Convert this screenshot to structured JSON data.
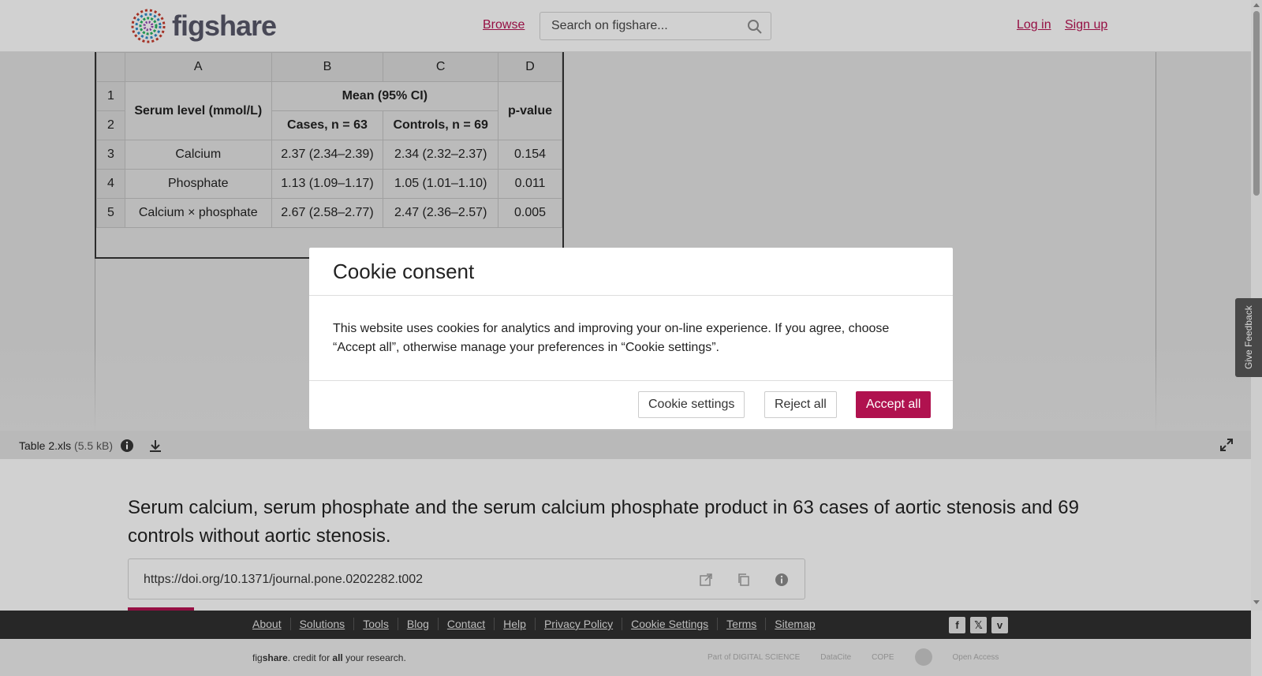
{
  "header": {
    "logo_text": "figshare",
    "browse": "Browse",
    "search_placeholder": "Search on figshare...",
    "login": "Log in",
    "signup": "Sign up"
  },
  "sheet": {
    "col_headers": [
      "A",
      "B",
      "C",
      "D"
    ],
    "row_numbers": [
      "1",
      "2",
      "3",
      "4",
      "5"
    ],
    "header_serum": "Serum level (mmol/L)",
    "header_mean": "Mean (95% CI)",
    "header_cases": "Cases, n = 63",
    "header_controls": "Controls, n = 69",
    "header_p": "p-value",
    "rows": [
      {
        "label": "Calcium",
        "cases": "2.37 (2.34–2.39)",
        "controls": "2.34 (2.32–2.37)",
        "p": "0.154"
      },
      {
        "label": "Phosphate",
        "cases": "1.13 (1.09–1.17)",
        "controls": "1.05 (1.01–1.10)",
        "p": "0.011"
      },
      {
        "label": "Calcium × phosphate",
        "cases": "2.67 (2.58–2.77)",
        "controls": "2.47 (2.36–2.57)",
        "p": "0.005"
      }
    ]
  },
  "file": {
    "name": "Table 2.xls",
    "size": "(5.5 kB)"
  },
  "content": {
    "title": "Serum calcium, serum phosphate and the serum calcium phosphate product in 63 cases of aortic stenosis and 69 controls without aortic stenosis.",
    "doi": "https://doi.org/10.1371/journal.pone.0202282.t002"
  },
  "feedback": "Give Feedback",
  "cookie": {
    "title": "Cookie consent",
    "body": "This website uses cookies for analytics and improving your on-line experience. If you agree, choose “Accept all”, otherwise manage your preferences in “Cookie settings”.",
    "settings": "Cookie settings",
    "reject": "Reject all",
    "accept": "Accept all"
  },
  "footer": {
    "links": [
      "About",
      "Solutions",
      "Tools",
      "Blog",
      "Contact",
      "Help",
      "Privacy Policy",
      "Cookie Settings",
      "Terms",
      "Sitemap"
    ],
    "social": [
      "f",
      "𝕏",
      "v"
    ],
    "credit_pre": "fig",
    "credit_bold": "share",
    "credit_mid": ". credit for ",
    "credit_all": "all",
    "credit_post": " your research.",
    "partners": [
      "Part of DIGITAL SCIENCE",
      "DataCite",
      "COPE",
      "",
      "Open Access"
    ]
  }
}
